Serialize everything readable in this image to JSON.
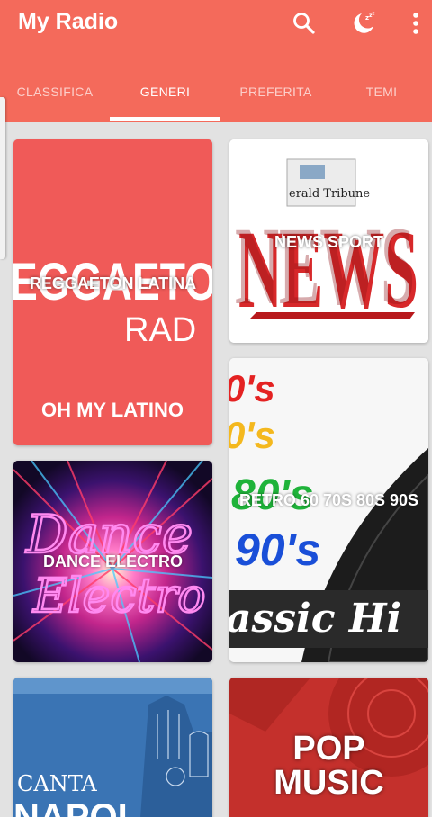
{
  "app": {
    "title": "My Radio"
  },
  "toolbar": {
    "icons": [
      "search-icon",
      "sleep-timer-icon",
      "overflow-menu-icon"
    ]
  },
  "tabs": [
    {
      "label": "CLASSIFICA",
      "active": false
    },
    {
      "label": "GENERI",
      "active": true
    },
    {
      "label": "PREFERITA",
      "active": false
    },
    {
      "label": "TEMI",
      "active": false
    }
  ],
  "genres": [
    {
      "label": "REGGAETON LATINA",
      "art_text": [
        "EGGAETO",
        "RAD",
        "OH MY LATINO"
      ]
    },
    {
      "label": "NEWS SPORT",
      "art_text": [
        "erald Tribune",
        "NEWS"
      ]
    },
    {
      "label": "DANCE ELECTRO",
      "art_text": [
        "Dance",
        "Electro"
      ]
    },
    {
      "label": "RETRO 60 70S 80S 90S",
      "art_text": [
        "0's",
        "0's",
        "80's",
        "90's",
        "assic Hi"
      ]
    },
    {
      "label": "",
      "art_text": [
        "CANTA",
        "NAPOL"
      ]
    },
    {
      "label": "POP MUSIC",
      "art_text": []
    }
  ],
  "colors": {
    "accent": "#f46a5b",
    "background": "#e2e2e2"
  }
}
